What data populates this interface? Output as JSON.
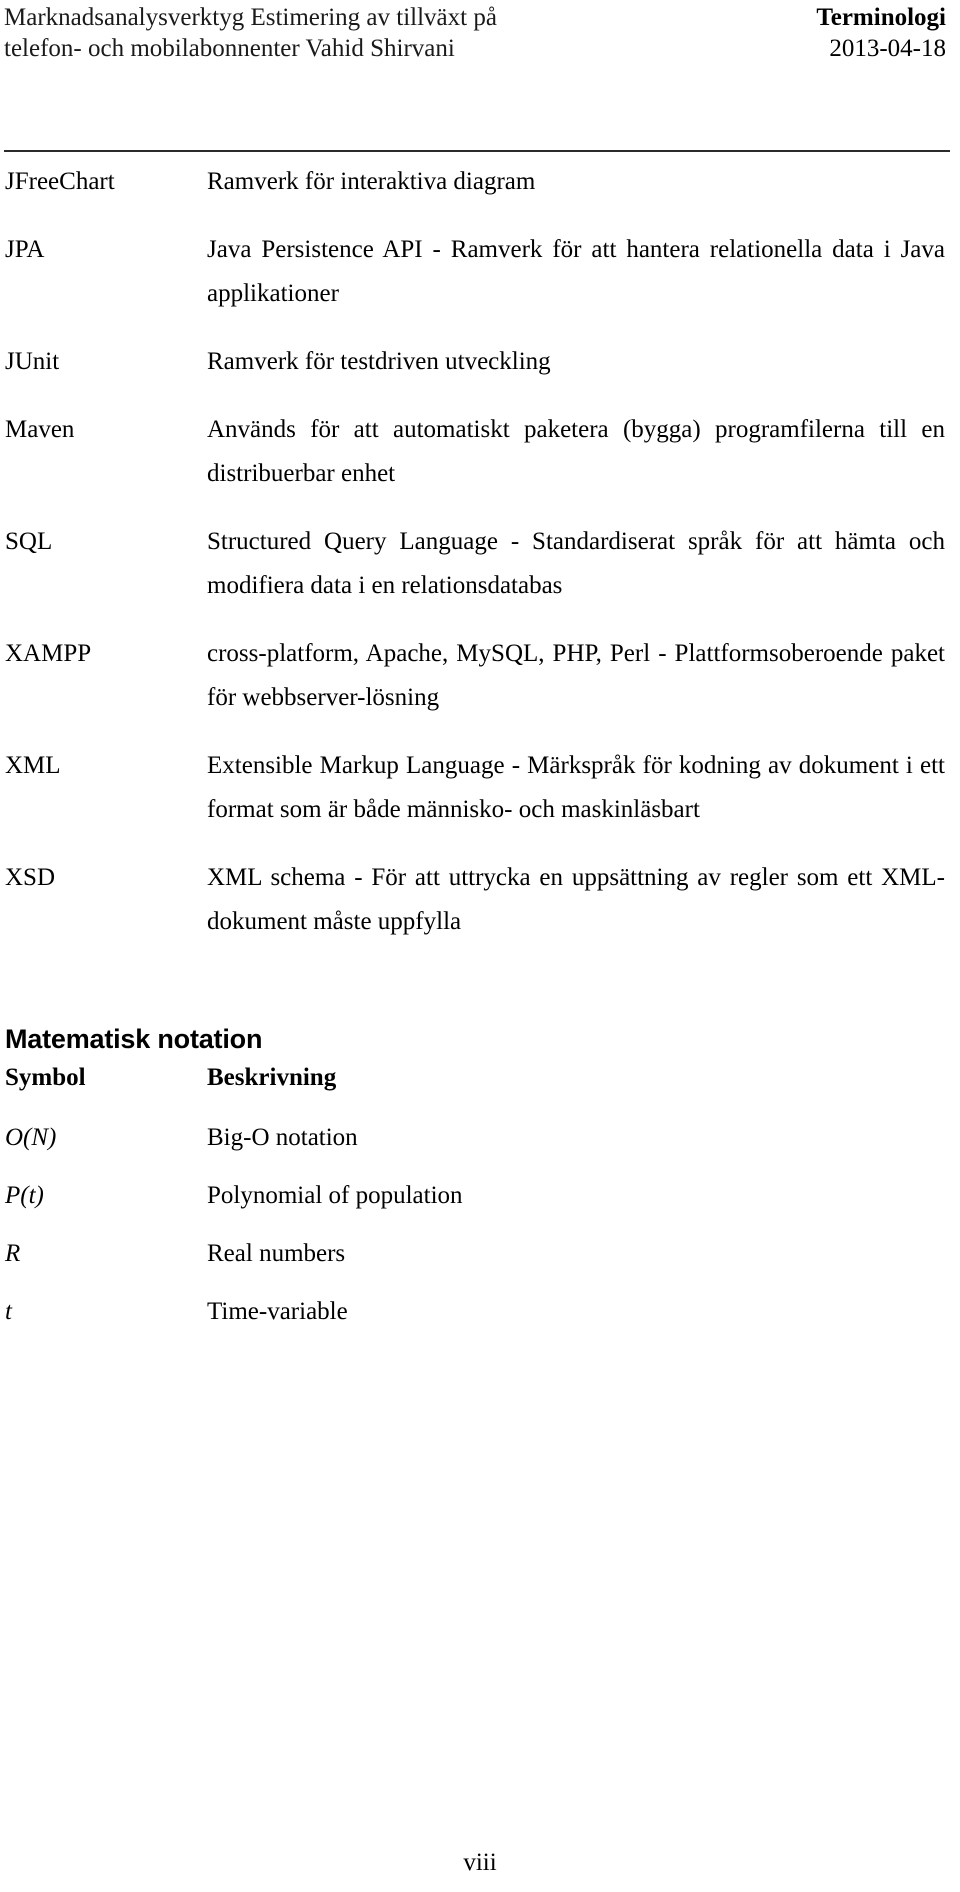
{
  "header": {
    "left_lines": [
      "Marknadsanalysverktyg",
      "Estimering av tillväxt på telefon-",
      "och mobilabonnenter Vahid",
      "Shirvani"
    ],
    "left_text": "Marknadsanalysverktyg Estimering av tillväxt på telefon- och mobilabonnenter Vahid Shirvani",
    "title": "Terminologi",
    "date": "2013-04-18"
  },
  "glossary": [
    {
      "term": "JFreeChart",
      "definition": "Ramverk för interaktiva diagram",
      "justified": false
    },
    {
      "term": "JPA",
      "definition": "Java Persistence API - Ramverk för att hantera relationella data i Java applikationer",
      "justified": true
    },
    {
      "term": "JUnit",
      "definition": "Ramverk för testdriven utveckling",
      "justified": false
    },
    {
      "term": "Maven",
      "definition": "Används för att automatiskt paketera (bygga) programfilerna till en distribuerbar enhet",
      "justified": true
    },
    {
      "term": "SQL",
      "definition": "Structured Query Language - Standardiserat språk för att hämta och modifiera data i en relationsdatabas",
      "justified": true
    },
    {
      "term": "XAMPP",
      "definition": "cross-platform, Apache, MySQL, PHP, Perl - Plattformsoberoende paket för webbserver-lösning",
      "justified": true
    },
    {
      "term": "XML",
      "definition": "Extensible Markup Language - Märkspråk för kodning av dokument i ett format som är både människo- och maskinläsbart",
      "justified": true
    },
    {
      "term": "XSD",
      "definition": "XML schema - För att uttrycka en uppsättning av regler som ett XML-dokument måste uppfylla",
      "justified": true
    }
  ],
  "math_section": {
    "heading": "Matematisk notation",
    "column_headers": {
      "symbol": "Symbol",
      "description": "Beskrivning"
    },
    "rows": [
      {
        "symbol": "O(N)",
        "description": "Big-O notation"
      },
      {
        "symbol": "P(t)",
        "description": "Polynomial of population"
      },
      {
        "symbol": "R",
        "description": "Real numbers"
      },
      {
        "symbol": "t",
        "description": "Time-variable"
      }
    ]
  },
  "footer": {
    "page_number": "viii"
  }
}
